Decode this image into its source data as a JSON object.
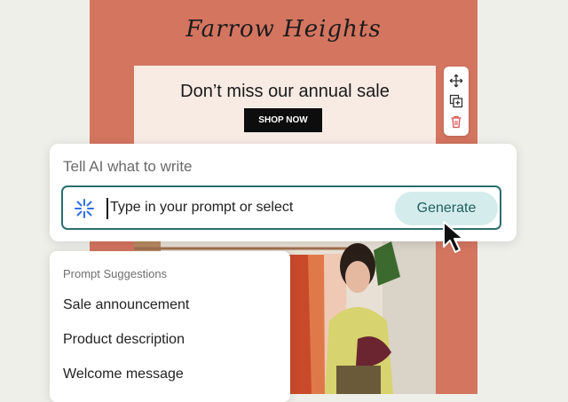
{
  "email": {
    "brand": "Farrow Heights",
    "sale_heading": "Don’t miss our annual sale",
    "shop_button": "SHOP NOW"
  },
  "toolbar": {
    "icons": [
      "move-icon",
      "duplicate-icon",
      "trash-icon"
    ]
  },
  "ai_panel": {
    "title": "Tell AI what to write",
    "prompt_placeholder": "Type in your prompt or select",
    "generate_label": "Generate"
  },
  "suggestions": {
    "title": "Prompt Suggestions",
    "items": [
      "Sale announcement",
      "Product description",
      "Welcome message"
    ]
  },
  "colors": {
    "canvas": "#d47560",
    "accent": "#2b6e6f",
    "generate_bg": "#d5ecec",
    "trash": "#d9534f"
  }
}
